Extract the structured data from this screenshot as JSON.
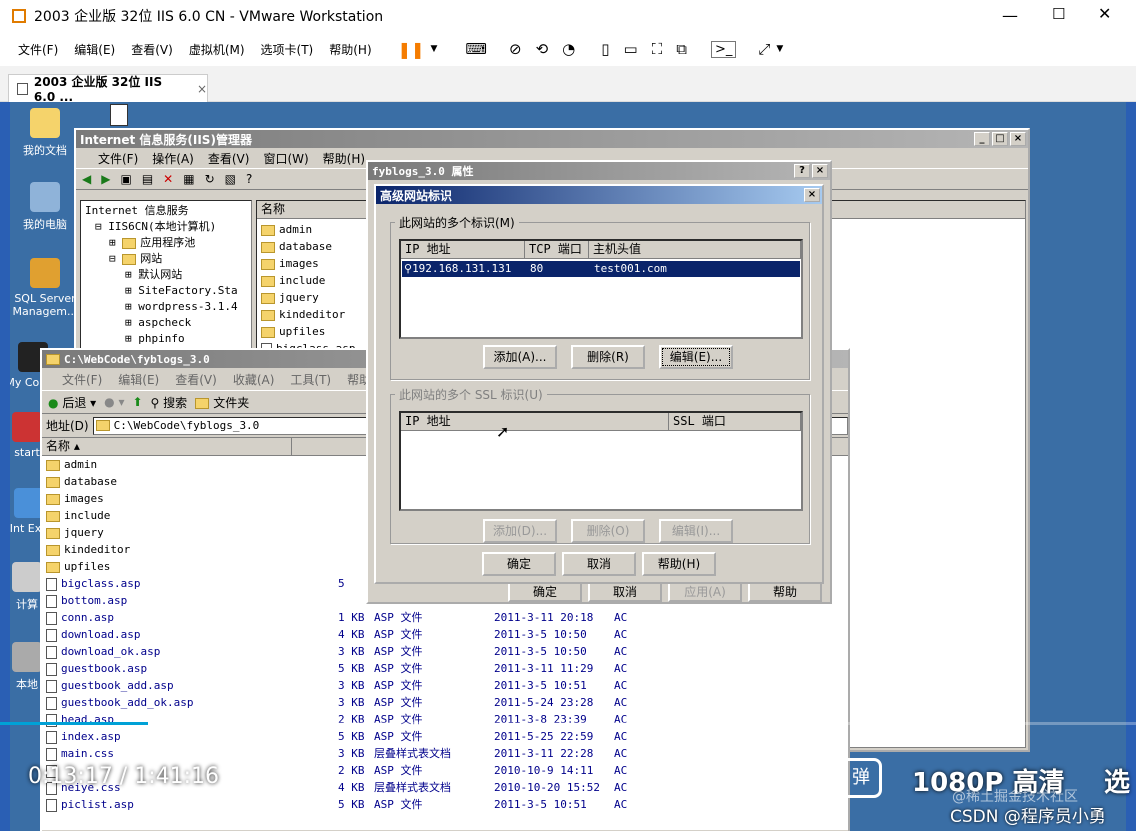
{
  "vm": {
    "title": "2003 企业版 32位 IIS 6.0 CN  - VMware Workstation",
    "menu": [
      "文件(F)",
      "编辑(E)",
      "查看(V)",
      "虚拟机(M)",
      "选项卡(T)",
      "帮助(H)"
    ],
    "tab": "2003 企业版 32位 IIS 6.0 ...",
    "tab_close": "×"
  },
  "desktop": {
    "icons": [
      "我的文档",
      "我的电脑",
      "SQL Server Managem...",
      "My Comm",
      "start",
      "Int Exp",
      "计算",
      "本地"
    ]
  },
  "iis": {
    "title": "Internet 信息服务(IIS)管理器",
    "menu": [
      "文件(F)",
      "操作(A)",
      "查看(V)",
      "窗口(W)",
      "帮助(H)"
    ],
    "tree": [
      "Internet 信息服务",
      "IIS6CN(本地计算机)",
      "应用程序池",
      "网站",
      "默认网站",
      "SiteFactory.Sta",
      "wordpress-3.1.4",
      "aspcheck",
      "phpinfo"
    ],
    "col": "名称",
    "files": [
      "admin",
      "database",
      "images",
      "include",
      "jquery",
      "kindeditor",
      "upfiles",
      "bigclass.asp"
    ]
  },
  "props": {
    "title": "fyblogs_3.0 属性",
    "help": "?",
    "close": "×",
    "buttons": [
      "确定",
      "取消",
      "应用(A)",
      "帮助"
    ]
  },
  "adv": {
    "title": "高级网站标识",
    "close": "×",
    "group1": "此网站的多个标识(M)",
    "cols1": [
      "IP 地址",
      "TCP 端口",
      "主机头值"
    ],
    "row": {
      "ip": "192.168.131.131",
      "port": "80",
      "host": "test001.com"
    },
    "btns1": [
      "添加(A)...",
      "删除(R)",
      "编辑(E)..."
    ],
    "group2": "此网站的多个 SSL 标识(U)",
    "cols2": [
      "IP 地址",
      "SSL 端口"
    ],
    "btns2": [
      "添加(D)...",
      "删除(O)",
      "编辑(I)..."
    ],
    "footer": [
      "确定",
      "取消",
      "帮助(H)"
    ]
  },
  "explorer": {
    "title": "C:\\WebCode\\fyblogs_3.0",
    "menu": [
      "文件(F)",
      "编辑(E)",
      "查看(V)",
      "收藏(A)",
      "工具(T)",
      "帮助"
    ],
    "back": "后退",
    "search": "搜索",
    "folders": "文件夹",
    "addr_label": "地址(D)",
    "addr": "C:\\WebCode\\fyblogs_3.0",
    "col": "名称",
    "dirs": [
      "admin",
      "database",
      "images",
      "include",
      "jquery",
      "kindeditor",
      "upfiles"
    ],
    "files": [
      {
        "name": "bigclass.asp",
        "size": "5",
        "type": "",
        "date": "",
        "attr": ""
      },
      {
        "name": "bottom.asp",
        "size": "",
        "type": "",
        "date": "",
        "attr": ""
      },
      {
        "name": "conn.asp",
        "size": "1 KB",
        "type": "ASP 文件",
        "date": "2011-3-11 20:18",
        "attr": "AC"
      },
      {
        "name": "download.asp",
        "size": "4 KB",
        "type": "ASP 文件",
        "date": "2011-3-5 10:50",
        "attr": "AC"
      },
      {
        "name": "download_ok.asp",
        "size": "3 KB",
        "type": "ASP 文件",
        "date": "2011-3-5 10:50",
        "attr": "AC"
      },
      {
        "name": "guestbook.asp",
        "size": "5 KB",
        "type": "ASP 文件",
        "date": "2011-3-11 11:29",
        "attr": "AC"
      },
      {
        "name": "guestbook_add.asp",
        "size": "3 KB",
        "type": "ASP 文件",
        "date": "2011-3-5 10:51",
        "attr": "AC"
      },
      {
        "name": "guestbook_add_ok.asp",
        "size": "3 KB",
        "type": "ASP 文件",
        "date": "2011-5-24 23:28",
        "attr": "AC"
      },
      {
        "name": "head.asp",
        "size": "2 KB",
        "type": "ASP 文件",
        "date": "2011-3-8 23:39",
        "attr": "AC"
      },
      {
        "name": "index.asp",
        "size": "5 KB",
        "type": "ASP 文件",
        "date": "2011-5-25 22:59",
        "attr": "AC"
      },
      {
        "name": "main.css",
        "size": "3 KB",
        "type": "层叠样式表文档",
        "date": "2011-3-11 22:28",
        "attr": "AC"
      },
      {
        "name": "",
        "size": "2 KB",
        "type": "ASP 文件",
        "date": "2010-10-9 14:11",
        "attr": "AC"
      },
      {
        "name": "neiye.css",
        "size": "4 KB",
        "type": "层叠样式表文档",
        "date": "2010-10-20 15:52",
        "attr": "AC"
      },
      {
        "name": "piclist.asp",
        "size": "5 KB",
        "type": "ASP 文件",
        "date": "2011-3-5 10:51",
        "attr": "AC"
      }
    ]
  },
  "video": {
    "time": "0:13:17 / 1:41:16",
    "quality": "1080P 高清",
    "select": "选",
    "wm1": "@稀土掘金技术社区",
    "wm2": "CSDN @程序员小勇",
    "progress": 0.13
  },
  "colors": {
    "vm_bg": "#ffffff",
    "desktop": "#3a6ea5",
    "title_active": "#0a246a",
    "select": "#0a246a",
    "accent": "#f57c00"
  }
}
